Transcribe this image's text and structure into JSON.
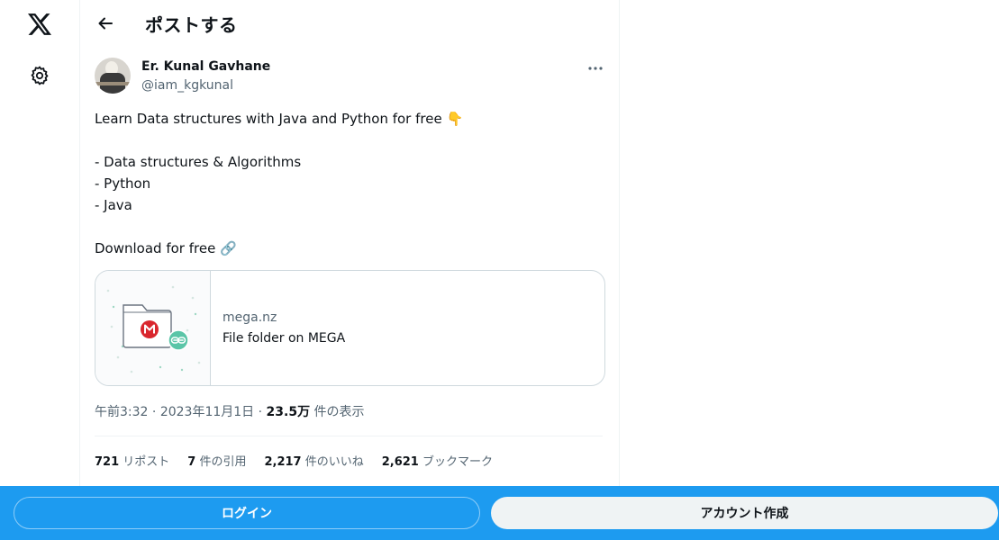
{
  "header": {
    "title": "ポストする"
  },
  "author": {
    "name": "Er. Kunal Gavhane",
    "handle": "@iam_kgkunal"
  },
  "tweet": {
    "line1": "Learn Data structures with Java and Python for free 👇",
    "line2": "- Data structures & Algorithms",
    "line3": "- Python",
    "line4": "- Java",
    "line5": "Download for free 🔗"
  },
  "card": {
    "domain": "mega.nz",
    "title": "File folder on MEGA"
  },
  "meta": {
    "time": "午前3:32",
    "sep1": " · ",
    "date": "2023年11月1日",
    "sep2": " · ",
    "views": "23.5万",
    "views_suffix": " 件の表示"
  },
  "stats": [
    {
      "count": "721",
      "label": " リポスト"
    },
    {
      "count": "7",
      "label": " 件の引用"
    },
    {
      "count": "2,217",
      "label": " 件のいいね"
    },
    {
      "count": "2,621",
      "label": " ブックマーク"
    }
  ],
  "bottom": {
    "login_label": "ログイン",
    "signup_label": "アカウント作成"
  },
  "icons": {
    "logo": "x-logo-icon",
    "settings": "gear-icon",
    "back": "back-arrow-icon",
    "more": "more-dots-icon",
    "mega": "mega-logo-icon",
    "link": "link-icon"
  },
  "colors": {
    "accent": "#1d9bf0",
    "text": "#0f1419",
    "muted": "#536471",
    "mega_red": "#d9272e",
    "link_green": "#5ac5a7"
  }
}
